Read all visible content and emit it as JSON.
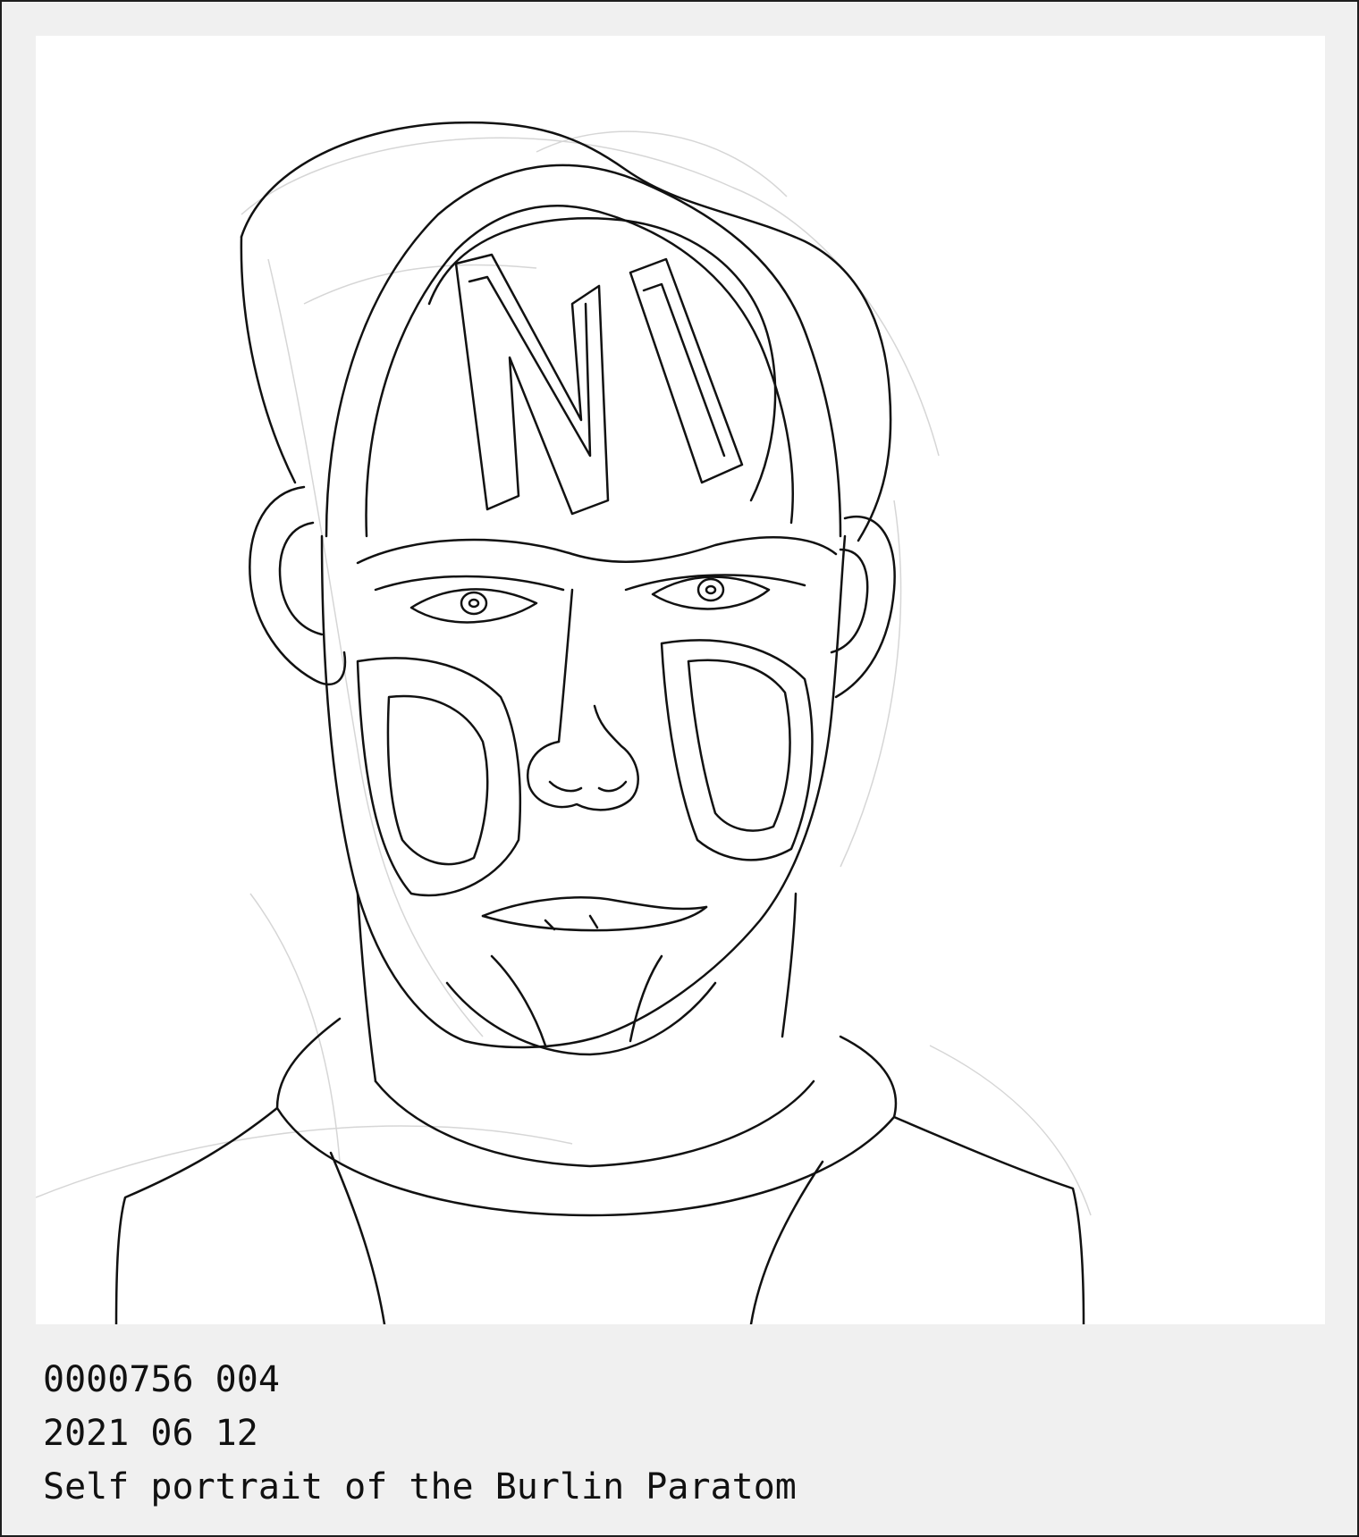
{
  "card": {
    "background_color": "#f0f0f0",
    "border_color": "#1e1e1e",
    "artwork_background": "#ffffff",
    "line_color": "#111111",
    "sketch_color": "#d6d6d6"
  },
  "artwork": {
    "icon": "line-drawing-portrait"
  },
  "caption": {
    "id_line": "0000756 004",
    "date_line": "2021 06 12",
    "title_line": "Self portrait of the Burlin Paratom"
  }
}
